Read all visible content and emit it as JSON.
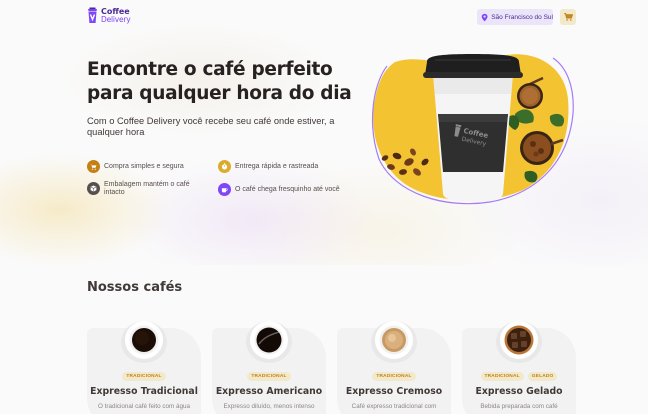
{
  "header": {
    "logo": {
      "line1": "Coffee",
      "line2": "Delivery"
    },
    "location": "São Francisco do Sul"
  },
  "hero": {
    "title": "Encontre o café perfeito para qualquer hora do dia",
    "subtitle": "Com o Coffee Delivery você recebe seu café onde estiver, a qualquer hora",
    "features": [
      {
        "label": "Compra simples e segura",
        "icon": "cart-icon",
        "color": "#c47f17"
      },
      {
        "label": "Entrega rápida e rastreada",
        "icon": "timer-icon",
        "color": "#dbac2c"
      },
      {
        "label": "Embalagem mantém o café intacto",
        "icon": "package-icon",
        "color": "#574f4d"
      },
      {
        "label": "O café chega fresquinho até você",
        "icon": "coffee-icon",
        "color": "#8047f8"
      }
    ],
    "cup_brand": {
      "line1": "Coffee",
      "line2": "Delivery"
    }
  },
  "catalog": {
    "title": "Nossos cafés",
    "items": [
      {
        "tags": [
          "TRADICIONAL"
        ],
        "name": "Expresso Tradicional",
        "description": "O tradicional café feito com água",
        "coffee": "black"
      },
      {
        "tags": [
          "TRADICIONAL"
        ],
        "name": "Expresso Americano",
        "description": "Expresso diluído, menos intenso",
        "coffee": "black"
      },
      {
        "tags": [
          "TRADICIONAL"
        ],
        "name": "Expresso Cremoso",
        "description": "Café expresso tradicional com",
        "coffee": "cream"
      },
      {
        "tags": [
          "TRADICIONAL",
          "GELADO"
        ],
        "name": "Expresso Gelado",
        "description": "Bebida preparada com café",
        "coffee": "iced"
      }
    ]
  },
  "colors": {
    "purple_dark": "#4b2995",
    "purple": "#8047f8",
    "yellow_dark": "#c47f17",
    "yellow": "#dbac2c",
    "card_bg": "#f3f2f2"
  }
}
